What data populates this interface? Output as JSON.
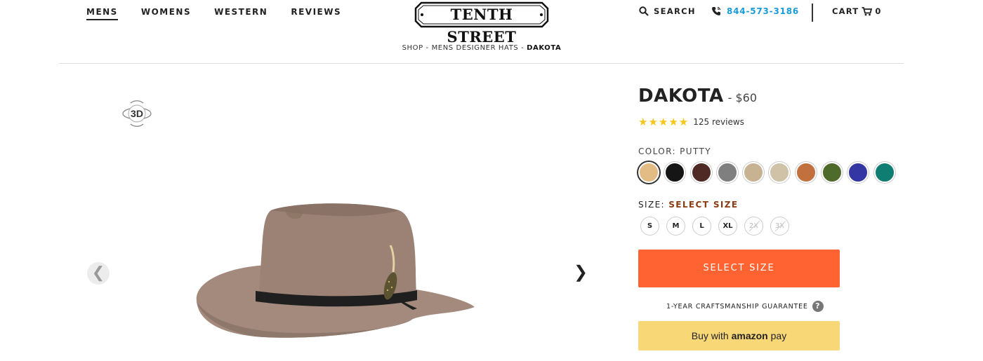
{
  "nav": {
    "items": [
      "MENS",
      "WOMENS",
      "WESTERN",
      "REVIEWS"
    ]
  },
  "logo": {
    "text": "TENTH STREET"
  },
  "header": {
    "search_label": "SEARCH",
    "phone": "844-573-3186",
    "cart_label": "CART",
    "cart_count": "0"
  },
  "breadcrumb": {
    "parts": [
      "SHOP",
      "MENS DESIGNER HATS",
      "DAKOTA"
    ],
    "sep": " - "
  },
  "gallery": {
    "badge": "3D",
    "prev": "❮",
    "next": "❯"
  },
  "product": {
    "name": "DAKOTA",
    "price": "- $60",
    "stars": "★★★★★",
    "reviews": "125 reviews",
    "color_label": "COLOR:",
    "color_value": "PUTTY",
    "colors": [
      "#e3bc85",
      "#151515",
      "#4f2a24",
      "#7f7f7f",
      "#c7b291",
      "#cfc2a6",
      "#c2703e",
      "#4f6b2c",
      "#3336a3",
      "#0f7d72"
    ],
    "size_label": "SIZE:",
    "size_value": "SELECT SIZE",
    "sizes": [
      {
        "label": "S",
        "available": true
      },
      {
        "label": "M",
        "available": true
      },
      {
        "label": "L",
        "available": true
      },
      {
        "label": "XL",
        "available": true
      },
      {
        "label": "2X",
        "available": false
      },
      {
        "label": "3X",
        "available": false
      }
    ],
    "select_button": "SELECT SIZE",
    "guarantee": "1-YEAR CRAFTSMANSHIP GUARANTEE",
    "guarantee_help": "?",
    "amazon_prefix": "Buy with",
    "amazon_brand": "amazon",
    "amazon_suffix": "pay"
  }
}
